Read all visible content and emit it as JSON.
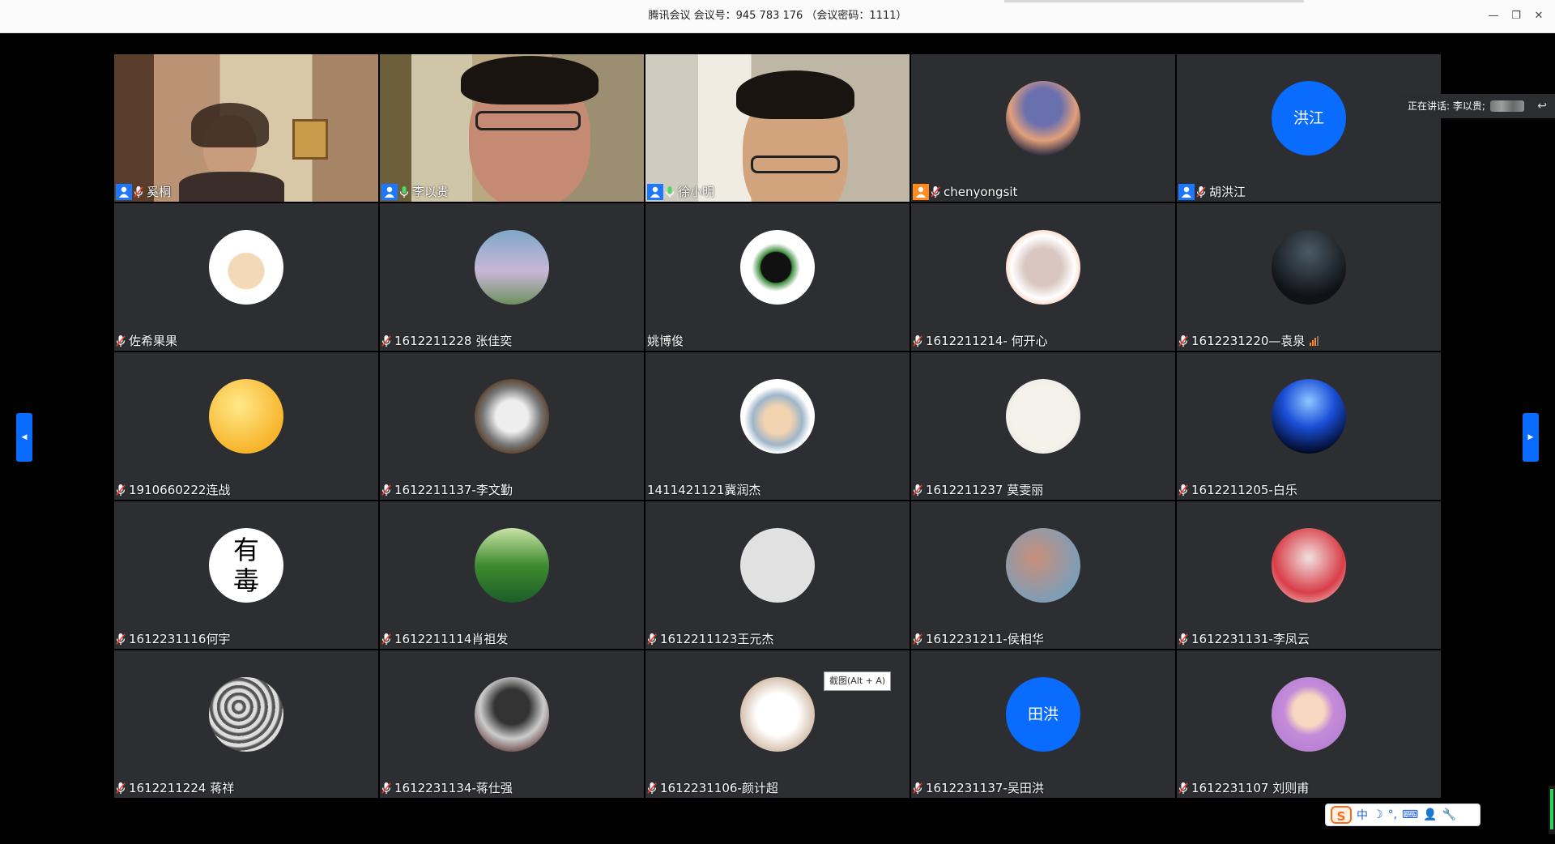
{
  "window": {
    "title": "腾讯会议 会议号：945 783 176 （会议密码：1111）",
    "minimize_icon": "minimize-icon",
    "restore_icon": "restore-icon",
    "close_icon": "close-icon"
  },
  "speaker": {
    "label": "正在讲话: 李以贵;"
  },
  "tooltip": {
    "text": "截图(Alt + A)"
  },
  "ime": {
    "lang": "中"
  },
  "colors": {
    "accent": "#0a6cff",
    "tile_bg": "#2c2e31",
    "active_speaker": "#1ec26b",
    "cohost": "#ff8a1e"
  },
  "participants": [
    {
      "name": "奚桐",
      "role": "host",
      "mic": "muted",
      "media": "video",
      "scene": "room-a"
    },
    {
      "name": "李以贵",
      "role": "host",
      "mic": "on",
      "media": "video",
      "scene": "room-b",
      "speaking": true
    },
    {
      "name": "徐小明",
      "role": "host",
      "mic": "on",
      "media": "video",
      "scene": "room-c"
    },
    {
      "name": "chenyongsit",
      "role": "cohost",
      "mic": "muted",
      "media": "avatar",
      "avatar": "dragon"
    },
    {
      "name": "胡洪江",
      "role": "host",
      "mic": "muted",
      "media": "text-avatar",
      "avatar_text": "洪江"
    },
    {
      "name": "佐希果果",
      "mic": "muted",
      "media": "avatar",
      "avatar": "bear"
    },
    {
      "name": "1612211228 张佳奕",
      "mic": "muted",
      "media": "avatar",
      "avatar": "child"
    },
    {
      "name": "姚博俊",
      "media": "avatar",
      "avatar": "dark-figure"
    },
    {
      "name": "1612211214- 何开心",
      "mic": "muted",
      "media": "avatar",
      "avatar": "anime-girl"
    },
    {
      "name": "1612231220—袁泉",
      "mic": "muted",
      "media": "avatar",
      "avatar": "night",
      "signal": true
    },
    {
      "name": "1910660222连战",
      "mic": "muted",
      "media": "avatar",
      "avatar": "smiley"
    },
    {
      "name": "1612211137-李文勤",
      "mic": "muted",
      "media": "avatar",
      "avatar": "ink"
    },
    {
      "name": "1411421121冀润杰",
      "media": "avatar",
      "avatar": "anime-hood"
    },
    {
      "name": "1612211237  莫雯丽",
      "mic": "muted",
      "media": "avatar",
      "avatar": "sketch"
    },
    {
      "name": "1612211205-白乐",
      "mic": "muted",
      "media": "avatar",
      "avatar": "blue-space"
    },
    {
      "name": "1612231116何宇",
      "mic": "muted",
      "media": "avatar",
      "avatar": "calligraphy",
      "avatar_text": "有\n毒"
    },
    {
      "name": "1612211114肖祖发",
      "mic": "muted",
      "media": "avatar",
      "avatar": "lotus"
    },
    {
      "name": "1612211123王元杰",
      "mic": "muted",
      "media": "avatar",
      "avatar": "default"
    },
    {
      "name": "1612231211-侯相华",
      "mic": "muted",
      "media": "avatar",
      "avatar": "blur-photo"
    },
    {
      "name": "1612231131-李凤云",
      "mic": "muted",
      "media": "avatar",
      "avatar": "umbrella"
    },
    {
      "name": "1612211224 蒋祥",
      "mic": "muted",
      "media": "avatar",
      "avatar": "bw-tunnel"
    },
    {
      "name": "1612231134-蒋仕强",
      "mic": "muted",
      "media": "avatar",
      "avatar": "hooded-figure"
    },
    {
      "name": "1612231106-颜计超",
      "mic": "muted",
      "media": "avatar",
      "avatar": "cat"
    },
    {
      "name": "1612231137-吴田洪",
      "mic": "muted",
      "media": "text-avatar",
      "avatar_text": "田洪"
    },
    {
      "name": "1612231107 刘则甫",
      "mic": "muted",
      "media": "avatar",
      "avatar": "cartoon-boy"
    }
  ]
}
